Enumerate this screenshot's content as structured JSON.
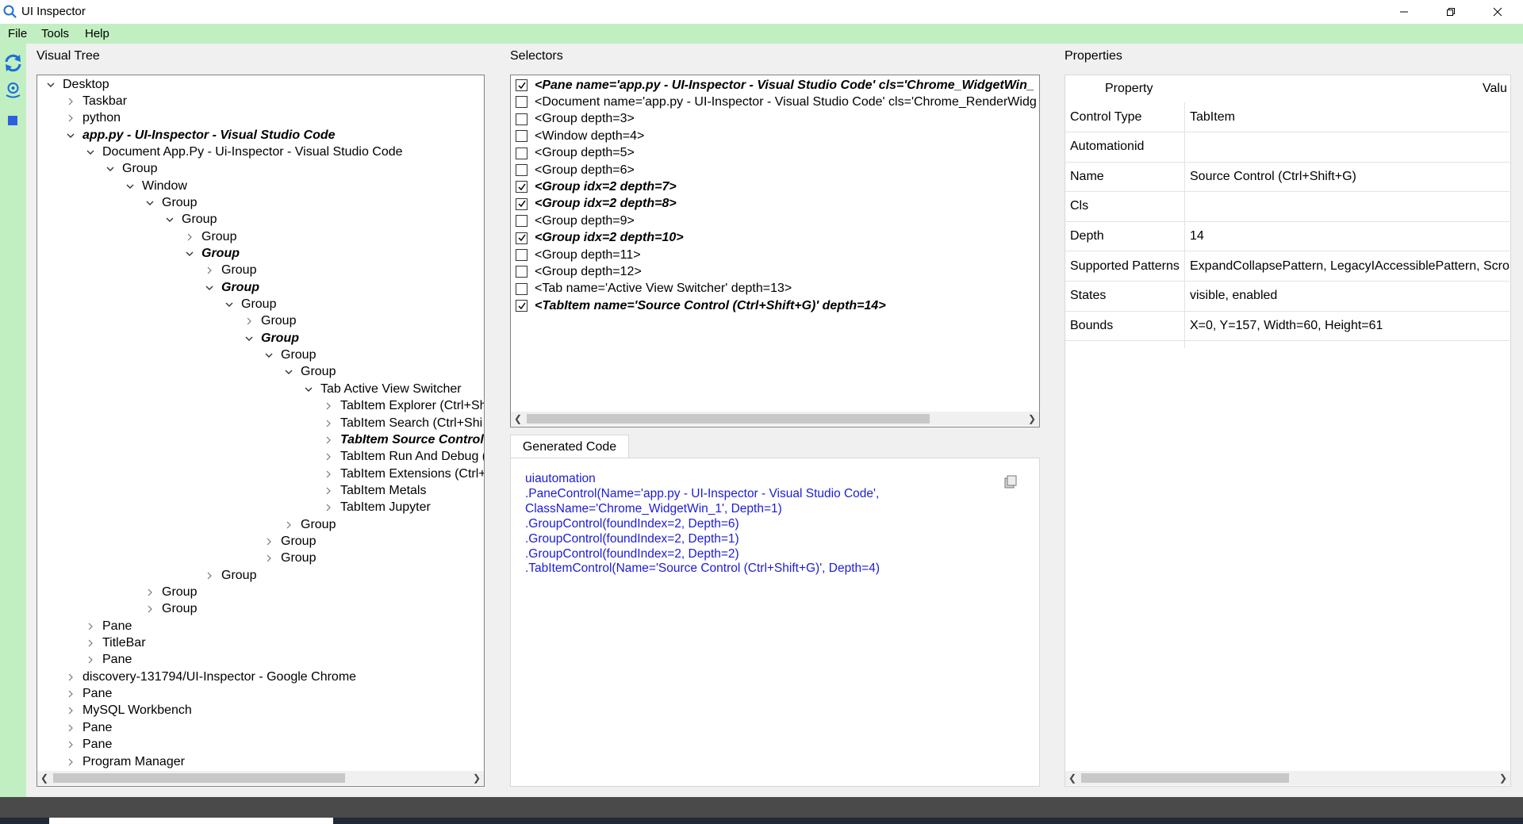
{
  "window": {
    "title": "UI Inspector"
  },
  "menu": {
    "file": "File",
    "tools": "Tools",
    "help": "Help"
  },
  "visual_tree": {
    "title": "Visual Tree",
    "rows": [
      {
        "label": "Desktop",
        "level": 0,
        "state": "open",
        "bold": false
      },
      {
        "label": "Taskbar",
        "level": 1,
        "state": "closed",
        "bold": false
      },
      {
        "label": "python",
        "level": 1,
        "state": "closed",
        "bold": false
      },
      {
        "label": "app.py - UI-Inspector - Visual Studio Code",
        "level": 1,
        "state": "open",
        "bold": true
      },
      {
        "label": "Document App.Py - Ui-Inspector - Visual Studio Code",
        "level": 2,
        "state": "open",
        "bold": false
      },
      {
        "label": "Group",
        "level": 3,
        "state": "open",
        "bold": false
      },
      {
        "label": "Window",
        "level": 4,
        "state": "open",
        "bold": false
      },
      {
        "label": "Group",
        "level": 5,
        "state": "open",
        "bold": false
      },
      {
        "label": "Group",
        "level": 6,
        "state": "open",
        "bold": false
      },
      {
        "label": "Group",
        "level": 7,
        "state": "closed",
        "bold": false
      },
      {
        "label": "Group",
        "level": 7,
        "state": "open",
        "bold": true
      },
      {
        "label": "Group",
        "level": 8,
        "state": "closed",
        "bold": false
      },
      {
        "label": "Group",
        "level": 8,
        "state": "open",
        "bold": true
      },
      {
        "label": "Group",
        "level": 9,
        "state": "open",
        "bold": false
      },
      {
        "label": "Group",
        "level": 10,
        "state": "closed",
        "bold": false
      },
      {
        "label": "Group",
        "level": 10,
        "state": "open",
        "bold": true
      },
      {
        "label": "Group",
        "level": 11,
        "state": "open",
        "bold": false
      },
      {
        "label": "Group",
        "level": 12,
        "state": "open",
        "bold": false
      },
      {
        "label": "Tab Active View Switcher",
        "level": 13,
        "state": "open",
        "bold": false
      },
      {
        "label": "TabItem Explorer (Ctrl+Sh",
        "level": 14,
        "state": "closed",
        "bold": false
      },
      {
        "label": "TabItem Search (Ctrl+Shi",
        "level": 14,
        "state": "closed",
        "bold": false
      },
      {
        "label": "TabItem Source Control",
        "level": 14,
        "state": "closed",
        "bold": true
      },
      {
        "label": "TabItem Run And Debug (",
        "level": 14,
        "state": "closed",
        "bold": false
      },
      {
        "label": "TabItem Extensions (Ctrl+",
        "level": 14,
        "state": "closed",
        "bold": false
      },
      {
        "label": "TabItem Metals",
        "level": 14,
        "state": "closed",
        "bold": false
      },
      {
        "label": "TabItem Jupyter",
        "level": 14,
        "state": "closed",
        "bold": false
      },
      {
        "label": "Group",
        "level": 12,
        "state": "closed",
        "bold": false
      },
      {
        "label": "Group",
        "level": 11,
        "state": "closed",
        "bold": false
      },
      {
        "label": "Group",
        "level": 11,
        "state": "closed",
        "bold": false
      },
      {
        "label": "Group",
        "level": 8,
        "state": "closed",
        "bold": false
      },
      {
        "label": "Group",
        "level": 5,
        "state": "closed",
        "bold": false
      },
      {
        "label": "Group",
        "level": 5,
        "state": "closed",
        "bold": false
      },
      {
        "label": "Pane",
        "level": 2,
        "state": "closed",
        "bold": false
      },
      {
        "label": "TitleBar",
        "level": 2,
        "state": "closed",
        "bold": false
      },
      {
        "label": "Pane",
        "level": 2,
        "state": "closed",
        "bold": false
      },
      {
        "label": "discovery-131794/UI-Inspector - Google Chrome",
        "level": 1,
        "state": "closed",
        "bold": false
      },
      {
        "label": "Pane",
        "level": 1,
        "state": "closed",
        "bold": false
      },
      {
        "label": "MySQL Workbench",
        "level": 1,
        "state": "closed",
        "bold": false
      },
      {
        "label": "Pane",
        "level": 1,
        "state": "closed",
        "bold": false
      },
      {
        "label": "Pane",
        "level": 1,
        "state": "closed",
        "bold": false
      },
      {
        "label": "Program Manager",
        "level": 1,
        "state": "closed",
        "bold": false
      }
    ]
  },
  "selectors": {
    "title": "Selectors",
    "rows": [
      {
        "label": "<Pane name='app.py - UI-Inspector - Visual Studio Code' cls='Chrome_WidgetWin_",
        "checked": true
      },
      {
        "label": "<Document name='app.py - UI-Inspector - Visual Studio Code' cls='Chrome_RenderWidg",
        "checked": false
      },
      {
        "label": "<Group depth=3>",
        "checked": false
      },
      {
        "label": "<Window depth=4>",
        "checked": false
      },
      {
        "label": "<Group depth=5>",
        "checked": false
      },
      {
        "label": "<Group depth=6>",
        "checked": false
      },
      {
        "label": "<Group idx=2 depth=7>",
        "checked": true
      },
      {
        "label": "<Group idx=2 depth=8>",
        "checked": true
      },
      {
        "label": "<Group depth=9>",
        "checked": false
      },
      {
        "label": "<Group idx=2 depth=10>",
        "checked": true
      },
      {
        "label": "<Group depth=11>",
        "checked": false
      },
      {
        "label": "<Group depth=12>",
        "checked": false
      },
      {
        "label": "<Tab name='Active View Switcher' depth=13>",
        "checked": false
      },
      {
        "label": "<TabItem name='Source Control (Ctrl+Shift+G)' depth=14>",
        "checked": true
      }
    ]
  },
  "generated_code": {
    "tab_label": "Generated Code",
    "lines": [
      "uiautomation",
      ".PaneControl(Name='app.py - UI-Inspector - Visual Studio Code',",
      "ClassName='Chrome_WidgetWin_1', Depth=1)",
      ".GroupControl(foundIndex=2, Depth=6)",
      ".GroupControl(foundIndex=2, Depth=1)",
      ".GroupControl(foundIndex=2, Depth=2)",
      ".TabItemControl(Name='Source Control (Ctrl+Shift+G)', Depth=4)"
    ]
  },
  "properties": {
    "title": "Properties",
    "header_property": "Property",
    "header_value": "Valu",
    "rows": [
      {
        "name": "Control Type",
        "value": "TabItem"
      },
      {
        "name": "Automationid",
        "value": ""
      },
      {
        "name": "Name",
        "value": "Source Control (Ctrl+Shift+G)"
      },
      {
        "name": "Cls",
        "value": ""
      },
      {
        "name": "Depth",
        "value": "14"
      },
      {
        "name": "Supported Patterns",
        "value": "ExpandCollapsePattern, LegacyIAccessiblePattern, Scro"
      },
      {
        "name": "States",
        "value": "visible, enabled"
      },
      {
        "name": "Bounds",
        "value": "X=0, Y=157, Width=60, Height=61"
      }
    ]
  },
  "icons": {
    "app": "magnifier-icon",
    "refresh": "refresh-icon",
    "locate": "locate-icon",
    "highlight": "square-icon",
    "copy": "copy-icon"
  },
  "colors": {
    "accent_green": "#c1efc1",
    "code_blue": "#1c1cd6",
    "refresh_blue": "#1e6fd9"
  }
}
